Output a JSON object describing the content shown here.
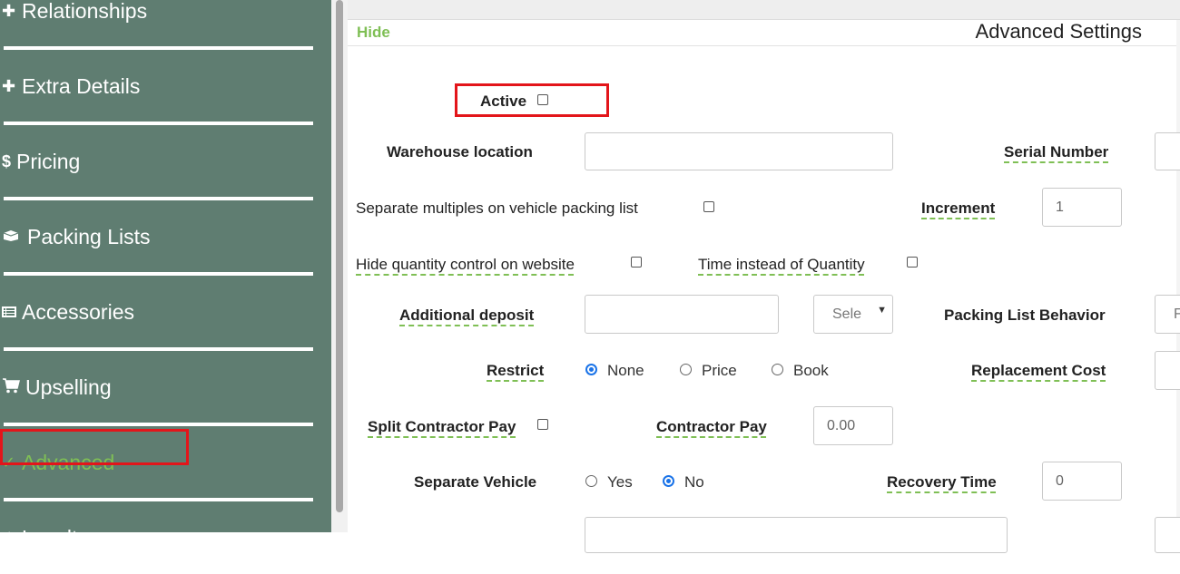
{
  "sidebar": {
    "items": [
      {
        "label": "Relationships",
        "icon": "plus-icon"
      },
      {
        "label": "Extra Details",
        "icon": "plus-icon"
      },
      {
        "label": "Pricing",
        "icon": "dollar-icon"
      },
      {
        "label": "Packing Lists",
        "icon": "box-icon"
      },
      {
        "label": "Accessories",
        "icon": "list-icon"
      },
      {
        "label": "Upselling",
        "icon": "cart-icon"
      },
      {
        "label": "Advanced",
        "icon": "check-icon"
      },
      {
        "label": "Loyalty",
        "icon": "star-icon"
      }
    ],
    "active_color": "#7fbf55",
    "bg_color": "#5f7d71"
  },
  "panel": {
    "hide_label": "Hide",
    "title": "Advanced Settings"
  },
  "form": {
    "active_label": "Active",
    "warehouse_label": "Warehouse location",
    "warehouse_value": "",
    "serial_label": "Serial Number",
    "separate_multiples_label": "Separate multiples on vehicle packing list",
    "increment_label": "Increment",
    "increment_value": "1",
    "hide_qty_label": "Hide quantity control on website",
    "time_instead_label": "Time instead of Quantity",
    "additional_deposit_label": "Additional deposit",
    "additional_deposit_select": "Sele",
    "packing_behavior_label": "Packing List Behavior",
    "packing_behavior_value": "F",
    "restrict_label": "Restrict",
    "restrict_options": [
      "None",
      "Price",
      "Book"
    ],
    "restrict_selected": "None",
    "replacement_cost_label": "Replacement Cost",
    "split_contractor_label": "Split Contractor Pay",
    "contractor_pay_label": "Contractor Pay",
    "contractor_pay_value": "0.00",
    "separate_vehicle_label": "Separate Vehicle",
    "separate_vehicle_options": [
      "Yes",
      "No"
    ],
    "separate_vehicle_selected": "No",
    "recovery_time_label": "Recovery Time",
    "recovery_time_value": "0"
  },
  "highlight_color": "#e3151a"
}
